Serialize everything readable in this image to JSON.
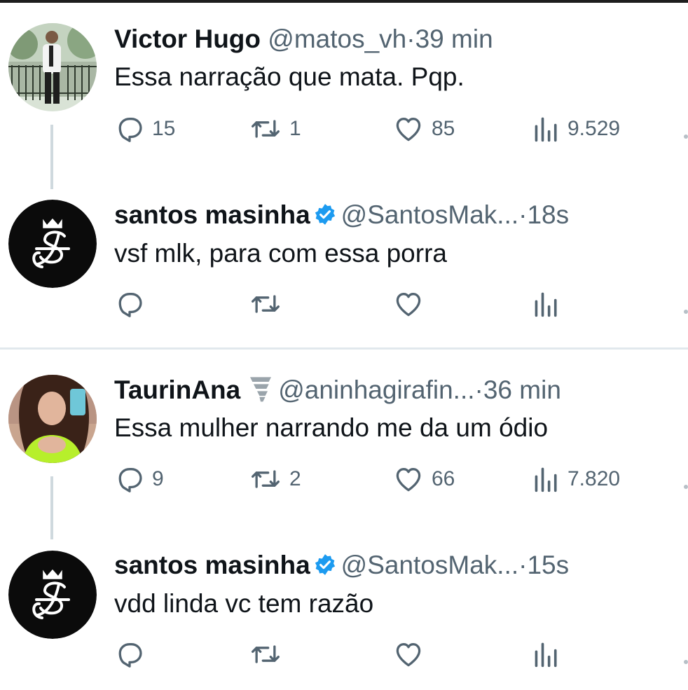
{
  "tweets": [
    {
      "name": "Victor Hugo",
      "handle": "@matos_vh",
      "time": "39 min",
      "text": "Essa narração que mata. Pqp.",
      "replies": "15",
      "retweets": "1",
      "likes": "85",
      "views": "9.529"
    },
    {
      "name": "santos masinha",
      "handle": "@SantosMak...",
      "time": "18s",
      "text": "vsf mlk, para com essa porra",
      "replies": "",
      "retweets": "",
      "likes": "",
      "views": ""
    },
    {
      "name": "TaurinAna",
      "handle": "@aninhagirafin...",
      "time": "36 min",
      "text": "Essa mulher narrando me da um ódio",
      "replies": "9",
      "retweets": "2",
      "likes": "66",
      "views": "7.820"
    },
    {
      "name": "santos masinha",
      "handle": "@SantosMak...",
      "time": "15s",
      "text": "vdd linda vc tem razão",
      "replies": "",
      "retweets": "",
      "likes": "",
      "views": ""
    }
  ],
  "separator": "·",
  "icons": {
    "reply": "reply-icon",
    "retweet": "retweet-icon",
    "like": "heart-icon",
    "views": "views-chart-icon",
    "verified": "verified-badge-icon",
    "tornado": "tornado-emoji-icon"
  },
  "colors": {
    "text": "#0f1419",
    "muted": "#536471",
    "verified": "#1d9bf0",
    "thread_line": "#cfd9de"
  }
}
